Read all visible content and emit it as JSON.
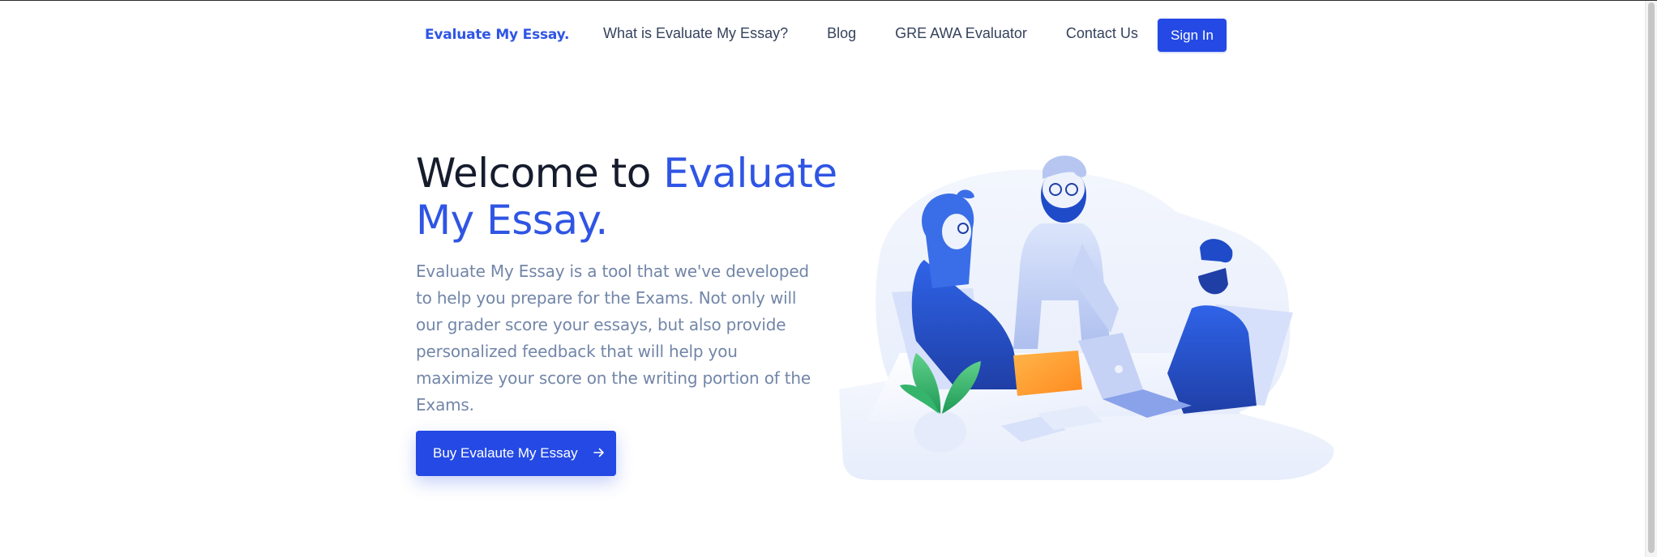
{
  "header": {
    "brand": "Evaluate My Essay.",
    "nav": [
      {
        "label": "What is Evaluate My Essay?"
      },
      {
        "label": "Blog"
      },
      {
        "label": "GRE AWA Evaluator"
      },
      {
        "label": "Contact Us"
      }
    ],
    "signin_label": "Sign In"
  },
  "hero": {
    "title_prefix": "Welcome to ",
    "title_accent": "Evaluate My Essay.",
    "description": "Evaluate My Essay is a tool that we've developed to help you prepare for the Exams. Not only will our grader score your essays, but also provide personalized feedback that will help you maximize your score on the writing portion of the Exams.",
    "cta_label": "Buy Evalaute My Essay",
    "cta_icon": "arrow-right-icon"
  },
  "colors": {
    "accent": "#2f55e4",
    "button": "#2449e4",
    "heading": "#161c2d",
    "body_text": "#7286a8",
    "nav_text": "#35425d"
  }
}
